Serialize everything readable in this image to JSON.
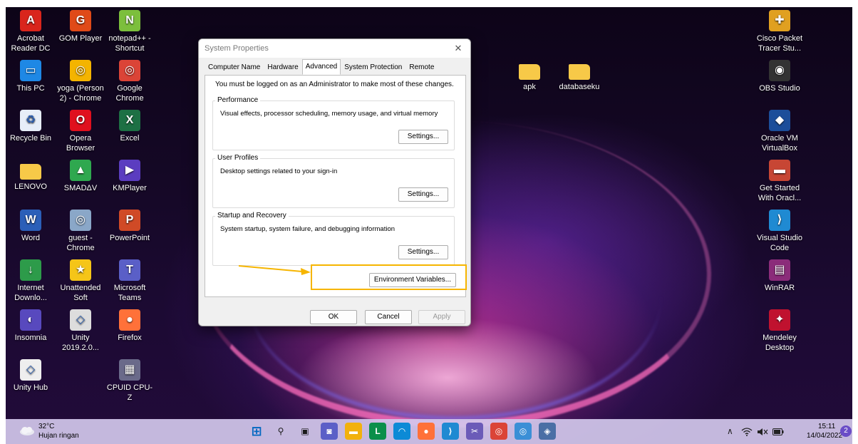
{
  "desktop_icons_left": [
    {
      "label": "Acrobat Reader DC",
      "icon": "acrobat-icon",
      "color": "#d9251c"
    },
    {
      "label": "GOM Player",
      "icon": "gom-player-icon",
      "color": "#e04a18"
    },
    {
      "label": "notepad++ - Shortcut",
      "icon": "notepadpp-icon",
      "color": "#7cbf3c"
    },
    {
      "label": "This PC",
      "icon": "this-pc-icon",
      "color": "#1e88e5"
    },
    {
      "label": "yoga (Person 2) - Chrome",
      "icon": "chrome-profile-icon",
      "color": "#f4b400"
    },
    {
      "label": "Google Chrome",
      "icon": "chrome-icon",
      "color": "#db4437"
    },
    {
      "label": "Recycle Bin",
      "icon": "recycle-bin-icon",
      "color": "#e7eef8"
    },
    {
      "label": "Opera Browser",
      "icon": "opera-icon",
      "color": "#e0101e"
    },
    {
      "label": "Excel",
      "icon": "excel-icon",
      "color": "#1d7044"
    },
    {
      "label": "LENOVO",
      "icon": "folder-icon",
      "color": "#f7c948"
    },
    {
      "label": "SMADΔV",
      "icon": "smadav-icon",
      "color": "#2fa84f"
    },
    {
      "label": "KMPlayer",
      "icon": "kmplayer-icon",
      "color": "#5b3dc0"
    },
    {
      "label": "Word",
      "icon": "word-icon",
      "color": "#2b5fb8"
    },
    {
      "label": "guest - Chrome",
      "icon": "chrome-guest-icon",
      "color": "#8aa7c8"
    },
    {
      "label": "PowerPoint",
      "icon": "powerpoint-icon",
      "color": "#d04a26"
    },
    {
      "label": "Internet Downlo...",
      "icon": "idm-icon",
      "color": "#2d9b4a"
    },
    {
      "label": "Unattended Soft",
      "icon": "star-icon",
      "color": "#f5c518"
    },
    {
      "label": "Microsoft Teams",
      "icon": "teams-icon",
      "color": "#5a5fc7"
    },
    {
      "label": "Insomnia",
      "icon": "insomnia-icon",
      "color": "#5849be"
    },
    {
      "label": "Unity 2019.2.0...",
      "icon": "unity-icon",
      "color": "#dddddd"
    },
    {
      "label": "Firefox",
      "icon": "firefox-icon",
      "color": "#ff7139"
    },
    {
      "label": "Unity Hub",
      "icon": "unity-hub-icon",
      "color": "#eeeeee"
    },
    {
      "label": "CPUID CPU-Z",
      "icon": "cpuz-icon",
      "color": "#6a6a8a"
    }
  ],
  "desktop_icons_mid": [
    {
      "label": "apk",
      "icon": "folder-icon",
      "color": "#f7c948"
    },
    {
      "label": "databaseku",
      "icon": "folder-icon",
      "color": "#f7c948"
    }
  ],
  "desktop_icons_right": [
    {
      "label": "Cisco Packet Tracer Stu...",
      "icon": "cisco-packet-tracer-icon",
      "color": "#e0a020"
    },
    {
      "label": "OBS Studio",
      "icon": "obs-icon",
      "color": "#333333"
    },
    {
      "label": "Oracle VM VirtualBox",
      "icon": "virtualbox-icon",
      "color": "#1c4e9a"
    },
    {
      "label": "Get Started With Oracl...",
      "icon": "oracle-db-icon",
      "color": "#c74634"
    },
    {
      "label": "Visual Studio Code",
      "icon": "vscode-icon",
      "color": "#1f8ad2"
    },
    {
      "label": "WinRAR",
      "icon": "winrar-icon",
      "color": "#8b2c7a"
    },
    {
      "label": "Mendeley Desktop",
      "icon": "mendeley-icon",
      "color": "#c0122f"
    }
  ],
  "dialog": {
    "title": "System Properties",
    "close_glyph": "✕",
    "tabs": [
      "Computer Name",
      "Hardware",
      "Advanced",
      "System Protection",
      "Remote"
    ],
    "active_tab": "Advanced",
    "admin_note": "You must be logged on as an Administrator to make most of these changes.",
    "performance": {
      "title": "Performance",
      "desc": "Visual effects, processor scheduling, memory usage, and virtual memory",
      "button": "Settings..."
    },
    "user_profiles": {
      "title": "User Profiles",
      "desc": "Desktop settings related to your sign-in",
      "button": "Settings..."
    },
    "startup_recovery": {
      "title": "Startup and Recovery",
      "desc": "System startup, system failure, and debugging information",
      "button": "Settings..."
    },
    "env_vars_button": "Environment Variables...",
    "ok": "OK",
    "cancel": "Cancel",
    "apply": "Apply",
    "highlight_color": "#f6b500"
  },
  "taskbar": {
    "weather_temp": "32°C",
    "weather_desc": "Hujan ringan",
    "apps": [
      {
        "icon": "windows-start-icon",
        "color": "#0067c0"
      },
      {
        "icon": "search-icon",
        "color": "#1a1a1a"
      },
      {
        "icon": "task-view-icon",
        "color": "#1a1a1a"
      },
      {
        "icon": "teams-chat-icon",
        "color": "#5b5fc7"
      },
      {
        "icon": "file-explorer-icon",
        "color": "#f2b10d"
      },
      {
        "icon": "lenovo-vantage-icon",
        "color": "#0a8f4a"
      },
      {
        "icon": "edge-icon",
        "color": "#0c8ad6"
      },
      {
        "icon": "firefox-icon",
        "color": "#ff7139"
      },
      {
        "icon": "vscode-icon",
        "color": "#1f8ad2"
      },
      {
        "icon": "snipping-tool-icon",
        "color": "#6b5bb8"
      },
      {
        "icon": "chrome-icon",
        "color": "#db4437"
      },
      {
        "icon": "chrome-profile-icon",
        "color": "#3b8fd6"
      },
      {
        "icon": "app-icon",
        "color": "#4a6fa5"
      }
    ],
    "tray": {
      "chevron": "∧",
      "wifi": "wifi-icon",
      "volume": "volume-icon",
      "battery": "battery-icon"
    },
    "time": "15:11",
    "date": "14/04/2022",
    "notifications": "2"
  }
}
